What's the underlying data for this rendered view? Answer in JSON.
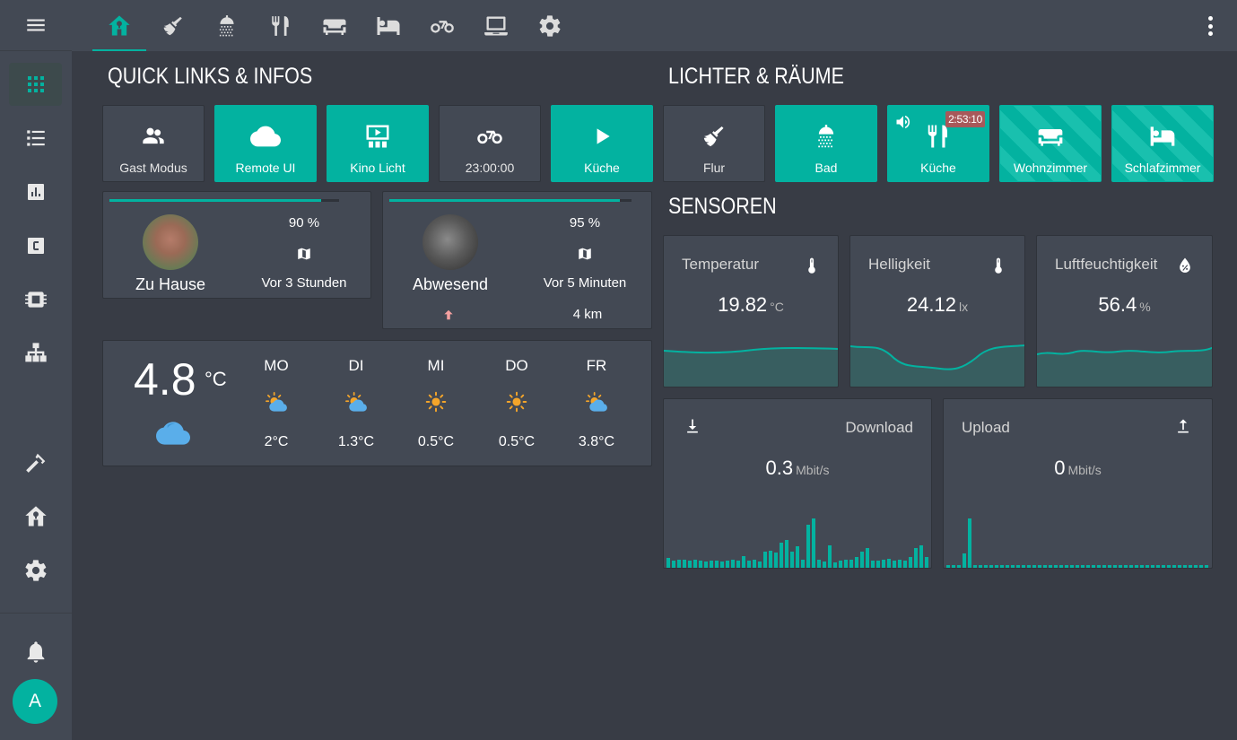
{
  "sidebar": {
    "menu_icon": "menu-icon",
    "items": [
      {
        "icon": "grid-icon",
        "active": true
      },
      {
        "icon": "list-icon",
        "active": false
      },
      {
        "icon": "chart-icon",
        "active": false
      },
      {
        "icon": "c-icon",
        "active": false
      },
      {
        "icon": "chip-icon",
        "active": false
      },
      {
        "icon": "sitemap-icon",
        "active": false
      },
      {
        "icon": "hammer-icon",
        "active": false
      },
      {
        "icon": "home-tree-icon",
        "active": false
      },
      {
        "icon": "gear-icon",
        "active": false
      }
    ],
    "notifications_icon": "bell-icon",
    "user_initial": "A"
  },
  "topbar": {
    "tabs": [
      "home-tree-icon",
      "broom-icon",
      "shower-icon",
      "cutlery-icon",
      "sofa-icon",
      "bed-icon",
      "bike-icon",
      "laptop-icon",
      "gear-icon"
    ],
    "active_tab": 0,
    "overflow_icon": "dots-vertical-icon"
  },
  "sections": {
    "quick_links": "QUICK LINKS & INFOS",
    "lights": "LICHTER & RÄUME",
    "sensors": "SENSOREN"
  },
  "quick_tiles": [
    {
      "label": "Gast Modus",
      "icon": "people-icon",
      "on": false
    },
    {
      "label": "Remote UI",
      "icon": "cloud-icon",
      "on": true
    },
    {
      "label": "Kino Licht",
      "icon": "theater-icon",
      "on": true
    },
    {
      "label": "23:00:00",
      "icon": "bike-icon",
      "on": false
    },
    {
      "label": "Küche",
      "icon": "play-icon",
      "on": true
    }
  ],
  "room_tiles": [
    {
      "label": "Flur",
      "icon": "broom-icon",
      "on": false
    },
    {
      "label": "Bad",
      "icon": "shower-icon",
      "on": true
    },
    {
      "label": "Küche",
      "icon": "cutlery-icon",
      "on": true,
      "timer": "2:53:10",
      "badge_icon": "speaker-icon"
    },
    {
      "label": "Wohnzimmer",
      "icon": "sofa-icon",
      "on": true,
      "striped": true
    },
    {
      "label": "Schlafzimmer",
      "icon": "bed-icon",
      "on": true,
      "striped": true
    }
  ],
  "persons": [
    {
      "name": "Zu Hause",
      "battery": "90 %",
      "battery_fraction": 0.92,
      "map_icon": "map-icon",
      "last_seen": "Vor 3 Stunden"
    },
    {
      "name": "Abwesend",
      "battery": "95 %",
      "battery_fraction": 0.95,
      "map_icon": "map-icon",
      "last_seen": "Vor 5 Minuten",
      "direction_icon": "arrow-up-icon",
      "distance": "4 km"
    }
  ],
  "weather": {
    "current_temp": "4.8",
    "unit": "°C",
    "current_icon": "cloud-icon",
    "forecast": [
      {
        "day": "MO",
        "icon": "sun-cloud-icon",
        "temp": "2°C"
      },
      {
        "day": "DI",
        "icon": "sun-cloud-icon",
        "temp": "1.3°C"
      },
      {
        "day": "MI",
        "icon": "sun-icon",
        "temp": "0.5°C"
      },
      {
        "day": "DO",
        "icon": "sun-icon",
        "temp": "0.5°C"
      },
      {
        "day": "FR",
        "icon": "sun-cloud-icon",
        "temp": "3.8°C"
      }
    ]
  },
  "sensors": [
    {
      "name": "Temperatur",
      "value": "19.82",
      "unit": "°C",
      "icon": "thermometer-icon"
    },
    {
      "name": "Helligkeit",
      "value": "24.12",
      "unit": "lx",
      "icon": "thermometer-icon"
    },
    {
      "name": "Luftfeuchtigkeit",
      "value": "56.4",
      "unit": "%",
      "icon": "water-percent-icon"
    }
  ],
  "network": [
    {
      "name": "Download",
      "value": "0.3",
      "unit": "Mbit/s",
      "icon": "download-icon"
    },
    {
      "name": "Upload",
      "value": "0",
      "unit": "Mbit/s",
      "icon": "upload-icon"
    }
  ],
  "colors": {
    "accent": "#03b2a0",
    "card": "#434954",
    "background": "#383c45"
  }
}
